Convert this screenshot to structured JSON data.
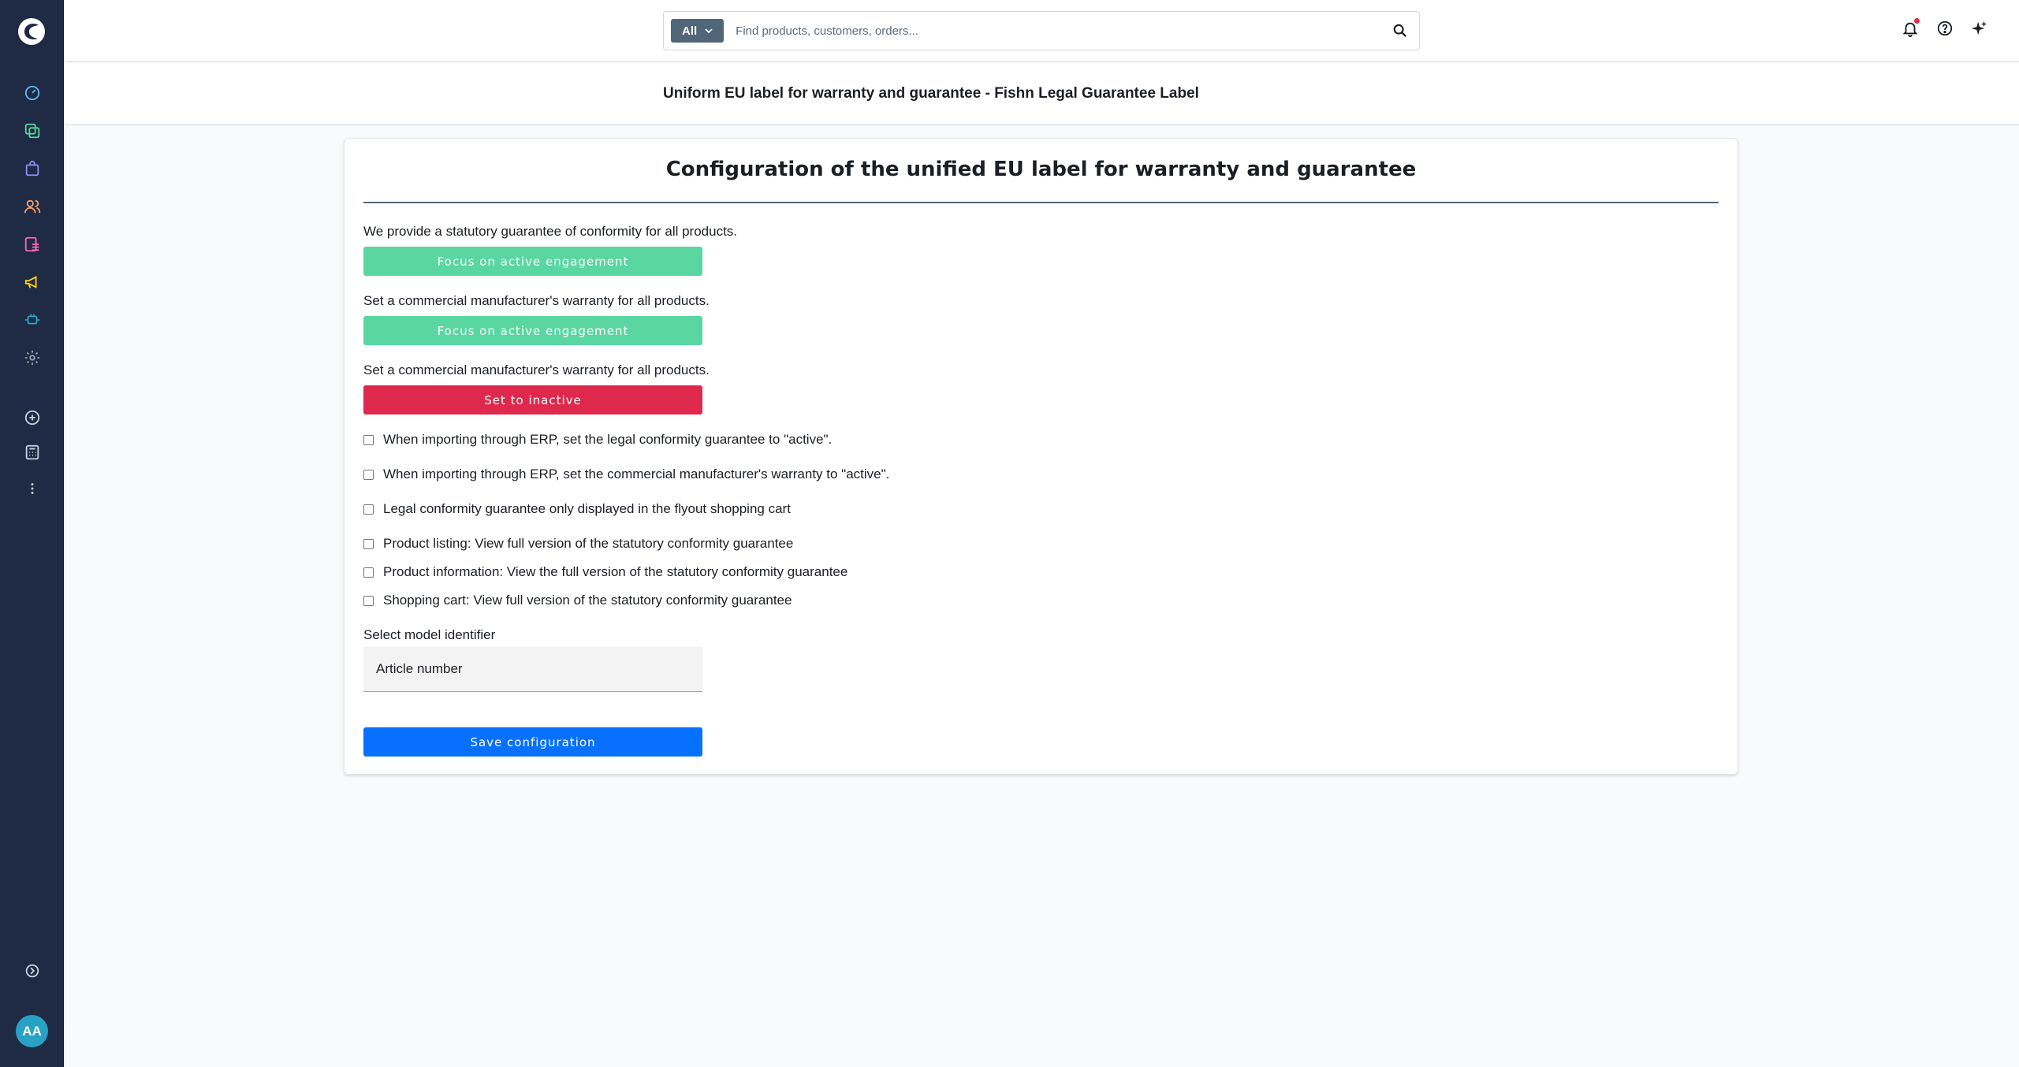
{
  "colors": {
    "sidebar_bg": "#1f2a44",
    "active_green": "#5ad6a0",
    "inactive_red": "#de294c",
    "primary_blue": "#0870ff"
  },
  "sidebar": {
    "logo_icon": "shopware-logo-icon",
    "items": [
      {
        "name": "dashboard",
        "icon": "gauge-icon",
        "color": "#5eb8f2"
      },
      {
        "name": "catalogues",
        "icon": "copy-icon",
        "color": "#5ad6a0"
      },
      {
        "name": "orders",
        "icon": "shopping-bag-icon",
        "color": "#8e8ef8"
      },
      {
        "name": "customers",
        "icon": "users-icon",
        "color": "#f5a068"
      },
      {
        "name": "content",
        "icon": "content-icon",
        "color": "#ff68b4"
      },
      {
        "name": "marketing",
        "icon": "megaphone-icon",
        "color": "#ffd700"
      },
      {
        "name": "extensions",
        "icon": "plug-icon",
        "color": "#27a2c4"
      },
      {
        "name": "settings",
        "icon": "gear-icon",
        "color": "#9aa5b1"
      },
      {
        "name": "add",
        "icon": "plus-circle-icon",
        "color": "#c8d1db"
      },
      {
        "name": "calculator",
        "icon": "calculator-icon",
        "color": "#c8d1db"
      },
      {
        "name": "more",
        "icon": "more-vertical-icon",
        "color": "#c8d1db"
      }
    ],
    "collapse_icon": "chevron-circle-icon",
    "avatar_initials": "AA"
  },
  "topbar": {
    "search_type": "All",
    "search_placeholder": "Find products, customers, orders..."
  },
  "page": {
    "title": "Uniform EU label for warranty and guarantee - Fishn Legal Guarantee Label"
  },
  "card": {
    "title": "Configuration of the unified EU label for warranty and guarantee",
    "sections": [
      {
        "label": "We provide a statutory guarantee of conformity for all products.",
        "button": "Focus on active engagement",
        "state": "active"
      },
      {
        "label": "Set a commercial manufacturer's warranty for all products.",
        "button": "Focus on active engagement",
        "state": "active"
      },
      {
        "label": "Set a commercial manufacturer's warranty for all products.",
        "button": "Set to inactive",
        "state": "inactive"
      }
    ],
    "checkboxes": [
      {
        "label": "When importing through ERP, set the legal conformity guarantee to \"active\".",
        "checked": false
      },
      {
        "label": "When importing through ERP, set the commercial manufacturer's warranty to \"active\".",
        "checked": false
      },
      {
        "label": "Legal conformity guarantee only displayed in the flyout shopping cart",
        "checked": false
      },
      {
        "label": "Product listing: View full version of the statutory conformity guarantee",
        "checked": false
      },
      {
        "label": "Product information: View the full version of the statutory conformity guarantee",
        "checked": false
      },
      {
        "label": "Shopping cart: View full version of the statutory conformity guarantee",
        "checked": false
      }
    ],
    "select_label": "Select model identifier",
    "select_value": "Article number",
    "save_button": "Save configuration"
  }
}
